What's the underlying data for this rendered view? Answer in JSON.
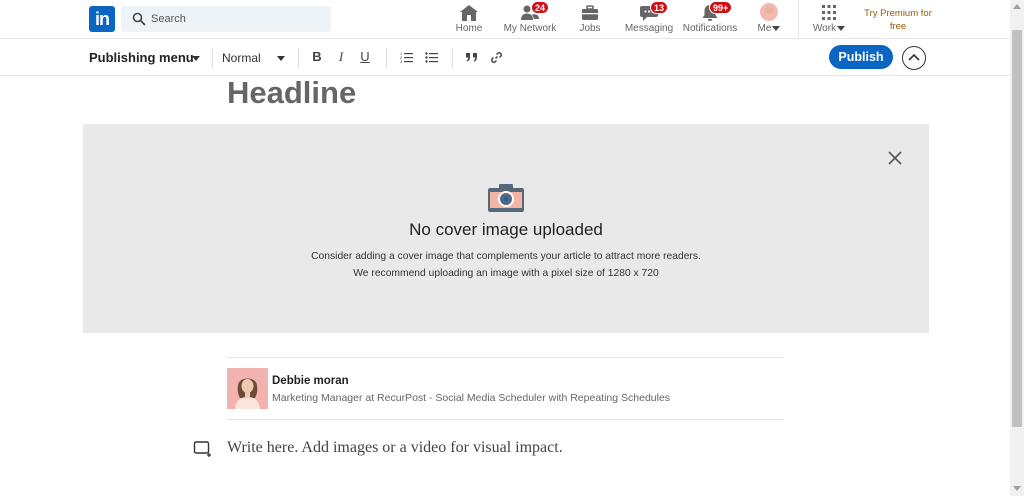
{
  "nav": {
    "logo_text": "in",
    "search_placeholder": "Search",
    "items": [
      {
        "label": "Home",
        "icon": "home-icon"
      },
      {
        "label": "My Network",
        "icon": "network-icon",
        "badge": "24"
      },
      {
        "label": "Jobs",
        "icon": "briefcase-icon"
      },
      {
        "label": "Messaging",
        "icon": "messaging-icon",
        "badge": "13"
      },
      {
        "label": "Notifications",
        "icon": "bell-icon",
        "badge": "99+"
      },
      {
        "label": "Me",
        "icon": "avatar"
      }
    ],
    "work_label": "Work",
    "premium_line1": "Try Premium for",
    "premium_line2": "free"
  },
  "toolbar": {
    "publishing_menu": "Publishing menu",
    "style_select": "Normal",
    "bold": "B",
    "italic": "I",
    "underline": "U",
    "publish": "Publish"
  },
  "article": {
    "headline": "Headline",
    "cover_title": "No cover image uploaded",
    "cover_desc_1": "Consider adding a cover image that complements your article to attract more readers.",
    "cover_desc_2": "We recommend uploading an image with a pixel size of 1280 x 720",
    "body_placeholder": "Write here. Add images or a video for visual impact."
  },
  "author": {
    "name": "Debbie moran",
    "title": "Marketing Manager at RecurPost - Social Media Scheduler with Repeating Schedules"
  },
  "colors": {
    "brand": "#0a66c2",
    "badge": "#cc1016",
    "premium": "#915907",
    "cover_bg": "#e9e9e9"
  }
}
